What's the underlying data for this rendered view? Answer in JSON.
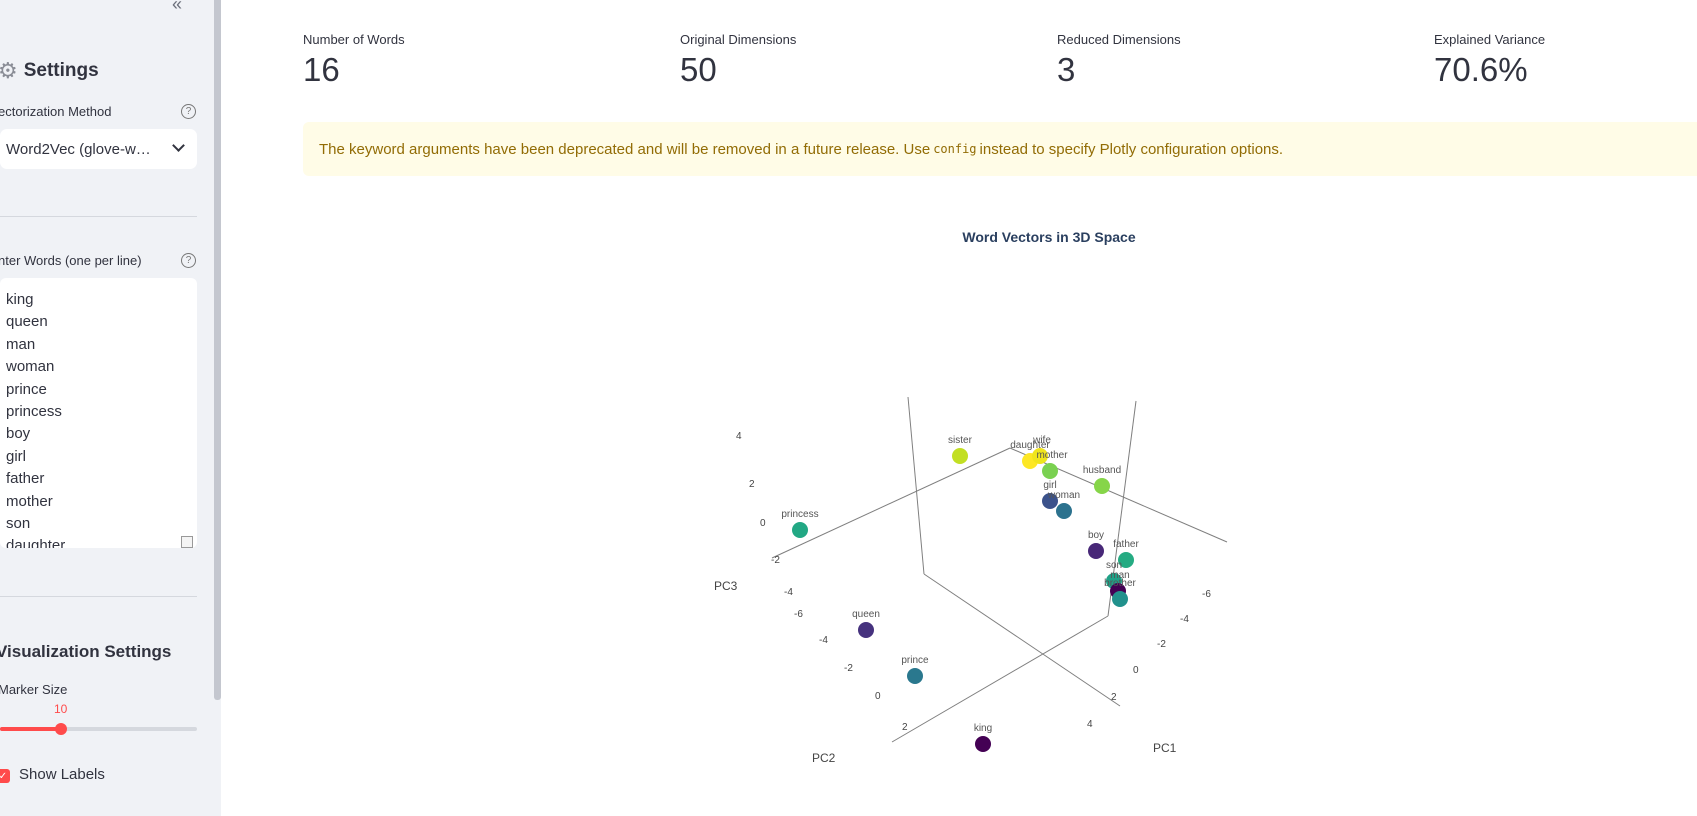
{
  "sidebar": {
    "collapse_icon": "«",
    "settings_title": "Settings",
    "vectorization_label": "ectorization Method",
    "vectorization_value": "Word2Vec (glove-w…",
    "words_label": "nter Words (one per line)",
    "words": [
      "king",
      "queen",
      "man",
      "woman",
      "prince",
      "princess",
      "boy",
      "girl",
      "father",
      "mother",
      "son",
      "daughter"
    ],
    "vis_title": "Visualization Settings",
    "marker_label": "Marker Size",
    "marker_value": "10",
    "marker_fraction": 0.31,
    "show_labels_label": "Show Labels",
    "show_labels_checked": true
  },
  "metrics": [
    {
      "label": "Number of Words",
      "value": "16"
    },
    {
      "label": "Original Dimensions",
      "value": "50"
    },
    {
      "label": "Reduced Dimensions",
      "value": "3"
    },
    {
      "label": "Explained Variance",
      "value": "70.6%"
    }
  ],
  "alert": {
    "before": "The keyword arguments have been deprecated and will be removed in a future release. Use",
    "code": "config",
    "after": "instead to specify Plotly configuration options."
  },
  "chart_data": {
    "type": "scatter",
    "title": "Word Vectors in 3D Space",
    "axes": {
      "x": "PC1",
      "y": "PC2",
      "z": "PC3"
    },
    "points": [
      {
        "label": "sister",
        "color": "#c2df23"
      },
      {
        "label": "daughter",
        "color": "#fde725"
      },
      {
        "label": "wife",
        "color": "#f0e51c"
      },
      {
        "label": "mother",
        "color": "#7ad151"
      },
      {
        "label": "husband",
        "color": "#86d549"
      },
      {
        "label": "girl",
        "color": "#3b528b"
      },
      {
        "label": "woman",
        "color": "#2c728e"
      },
      {
        "label": "princess",
        "color": "#22a884"
      },
      {
        "label": "boy",
        "color": "#482878"
      },
      {
        "label": "father",
        "color": "#25ab82"
      },
      {
        "label": "son",
        "color": "#1fa187"
      },
      {
        "label": "man",
        "color": "#440154"
      },
      {
        "label": "brother",
        "color": "#21918c"
      },
      {
        "label": "queen",
        "color": "#46327e"
      },
      {
        "label": "prince",
        "color": "#2a788e"
      },
      {
        "label": "king",
        "color": "#440154"
      }
    ],
    "tick_labels": {
      "z": [
        "4",
        "2",
        "0",
        "-2",
        "-4"
      ],
      "y": [
        "-6",
        "-4",
        "-2",
        "0",
        "2"
      ],
      "x": [
        "-6",
        "-4",
        "-2",
        "0",
        "2",
        "4"
      ]
    }
  }
}
